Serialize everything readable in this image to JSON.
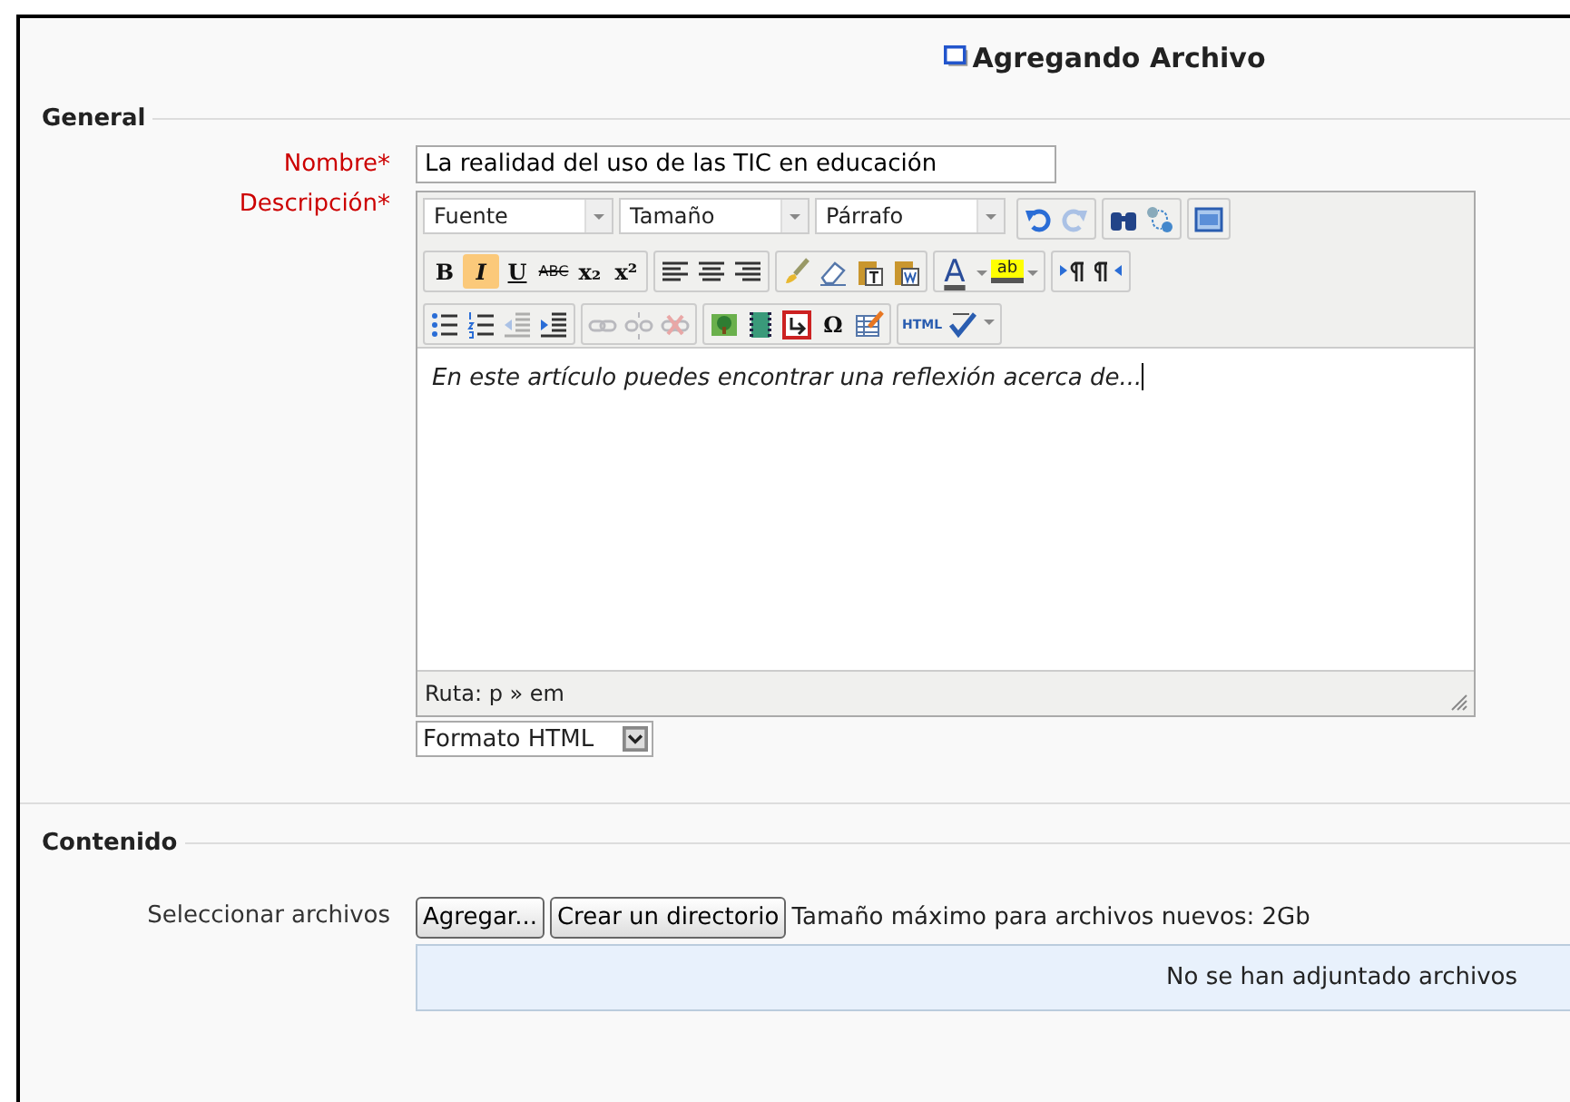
{
  "header": {
    "title": "Agregando Archivo"
  },
  "sections": [
    {
      "legend": "General"
    },
    {
      "legend": "Contenido"
    }
  ],
  "name_field": {
    "label": "Nombre",
    "required_mark": "*",
    "value": "La realidad del uso de las TIC en educación"
  },
  "description": {
    "label": "Descripción",
    "required_mark": "*",
    "toolbar": [
      [
        [
          {
            "kind": "select",
            "label": "Fuente"
          },
          {
            "kind": "select",
            "label": "Tamaño"
          },
          {
            "kind": "select",
            "label": "Párrafo"
          }
        ],
        [
          {
            "kind": "undo",
            "disabled": false
          },
          {
            "kind": "redo",
            "disabled": true
          }
        ],
        [
          {
            "kind": "find",
            "disabled": false
          },
          {
            "kind": "replace",
            "disabled": false
          }
        ],
        [
          {
            "kind": "fullscreen",
            "disabled": false
          }
        ]
      ],
      [
        [
          {
            "kind": "bold",
            "label": "B",
            "active": false
          },
          {
            "kind": "italic",
            "label": "I",
            "active": true
          },
          {
            "kind": "underline",
            "label": "U",
            "active": false
          },
          {
            "kind": "strike",
            "label": "ABC",
            "active": false
          },
          {
            "kind": "subscript",
            "label": "x₂",
            "active": false
          },
          {
            "kind": "superscript",
            "label": "x²",
            "active": false
          }
        ],
        [
          {
            "kind": "align-left",
            "disabled": false
          },
          {
            "kind": "align-center",
            "disabled": false
          },
          {
            "kind": "align-right",
            "disabled": false
          }
        ],
        [
          {
            "kind": "brush",
            "disabled": false
          },
          {
            "kind": "eraser",
            "disabled": false
          },
          {
            "kind": "paste-text",
            "disabled": false
          },
          {
            "kind": "paste-word",
            "disabled": false
          }
        ],
        [
          {
            "kind": "color-text",
            "label": "A"
          },
          {
            "kind": "color-highlight",
            "label": "ab"
          }
        ],
        [
          {
            "kind": "ltr",
            "disabled": false
          },
          {
            "kind": "rtl",
            "disabled": false
          }
        ]
      ],
      [
        [
          {
            "kind": "bullets",
            "disabled": false
          },
          {
            "kind": "numbers",
            "disabled": false
          },
          {
            "kind": "outdent",
            "disabled": true
          },
          {
            "kind": "indent",
            "disabled": false
          }
        ],
        [
          {
            "kind": "link",
            "disabled": true
          },
          {
            "kind": "unlink",
            "disabled": true
          },
          {
            "kind": "nolink",
            "disabled": true
          }
        ],
        [
          {
            "kind": "image",
            "disabled": false
          },
          {
            "kind": "media",
            "disabled": false
          },
          {
            "kind": "nonbreak",
            "disabled": false
          },
          {
            "kind": "symbol",
            "label": "Ω",
            "active": false
          },
          {
            "kind": "table-edit",
            "disabled": false
          }
        ],
        [
          {
            "kind": "html",
            "label": "HTML",
            "active": false
          },
          {
            "kind": "spell",
            "disabled": false
          }
        ]
      ]
    ],
    "content": "En este artículo puedes encontrar una reflexión acerca de...",
    "path": "Ruta: p » em",
    "format": "Formato HTML"
  },
  "files": {
    "label": "Seleccionar archivos",
    "buttons": [
      "Agregar...",
      "Crear un directorio"
    ],
    "max_size": "Tamaño máximo para archivos nuevos: 2Gb",
    "empty_message": "No se han adjuntado archivos"
  }
}
